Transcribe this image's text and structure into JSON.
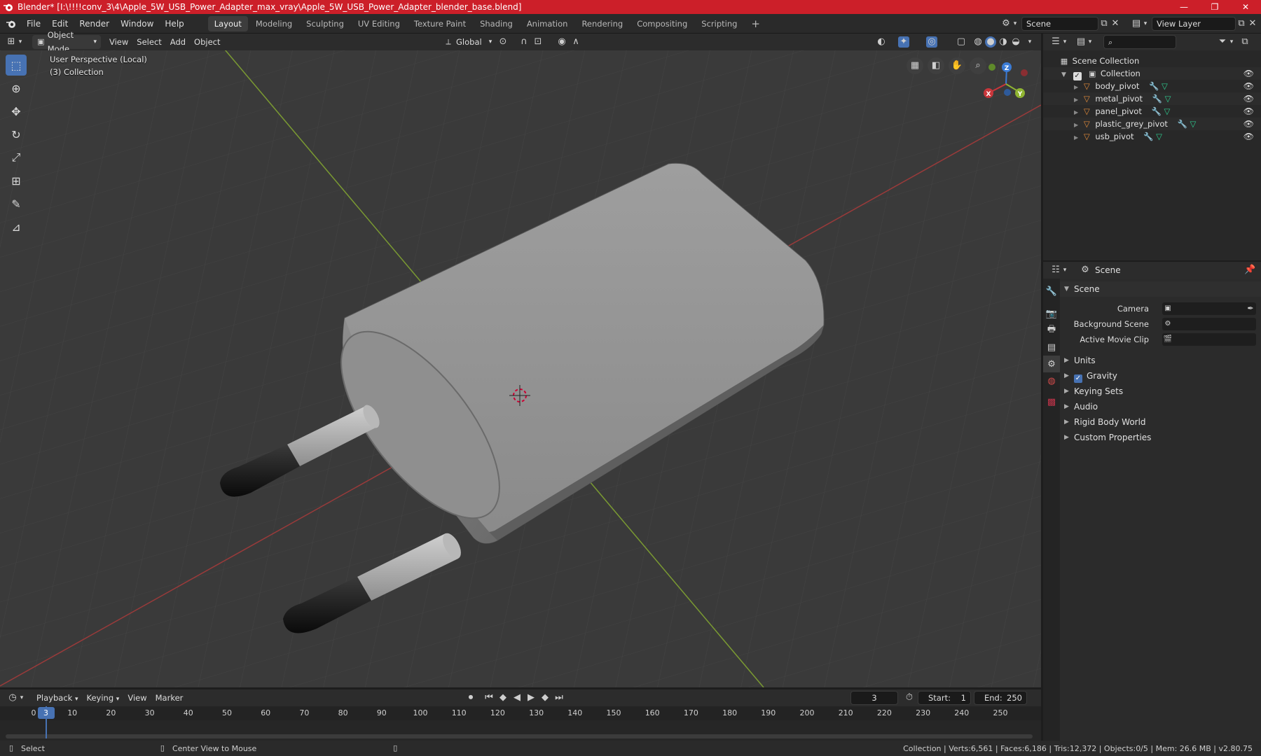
{
  "window": {
    "title": "Blender* [I:\\!!!!conv_3\\4\\Apple_5W_USB_Power_Adapter_max_vray\\Apple_5W_USB_Power_Adapter_blender_base.blend]",
    "minimize": "—",
    "maximize": "❐",
    "close": "✕"
  },
  "menu": [
    "File",
    "Edit",
    "Render",
    "Window",
    "Help"
  ],
  "workspaces": [
    "Layout",
    "Modeling",
    "Sculpting",
    "UV Editing",
    "Texture Paint",
    "Shading",
    "Animation",
    "Rendering",
    "Compositing",
    "Scripting"
  ],
  "active_workspace": "Layout",
  "add_workspace": "+",
  "scene_field": "Scene",
  "view_layer_field": "View Layer",
  "viewport_header": {
    "mode": "Object Mode",
    "menus": [
      "View",
      "Select",
      "Add",
      "Object"
    ],
    "orientation": "Global"
  },
  "viewport": {
    "perspective": "User Perspective (Local)",
    "collection": "(3) Collection",
    "gizmo": {
      "x": "X",
      "y": "Y",
      "z": "Z"
    }
  },
  "outliner": {
    "root": "Scene Collection",
    "collection": "Collection",
    "items": [
      "body_pivot",
      "metal_pivot",
      "panel_pivot",
      "plastic_grey_pivot",
      "usb_pivot"
    ]
  },
  "properties": {
    "header": "Scene",
    "panel_title": "Scene",
    "fields": [
      {
        "label": "Camera"
      },
      {
        "label": "Background Scene"
      },
      {
        "label": "Active Movie Clip"
      }
    ],
    "panels": [
      "Units",
      "Gravity",
      "Keying Sets",
      "Audio",
      "Rigid Body World",
      "Custom Properties"
    ],
    "gravity_checked": true
  },
  "timeline": {
    "menus": [
      "Playback",
      "Keying",
      "View",
      "Marker"
    ],
    "current_frame": "3",
    "start_label": "Start:",
    "start": "1",
    "end_label": "End:",
    "end": "250",
    "ruler": [
      "0",
      "10",
      "20",
      "30",
      "40",
      "50",
      "60",
      "70",
      "80",
      "90",
      "100",
      "110",
      "120",
      "130",
      "140",
      "150",
      "160",
      "170",
      "180",
      "190",
      "200",
      "210",
      "220",
      "230",
      "240",
      "250"
    ],
    "playhead_label": "3"
  },
  "status": {
    "select": "Select",
    "center_view": "Center View to Mouse",
    "info": "Collection | Verts:6,561 | Faces:6,186 | Tris:12,372 | Objects:0/5 | Mem: 26.6 MB | v2.80.75"
  },
  "colors": {
    "titlebar": "#cc1f29",
    "accent": "#4772b3",
    "x_axis": "#c9363b",
    "y_axis": "#8fb432",
    "z_axis": "#3a7bd5"
  }
}
